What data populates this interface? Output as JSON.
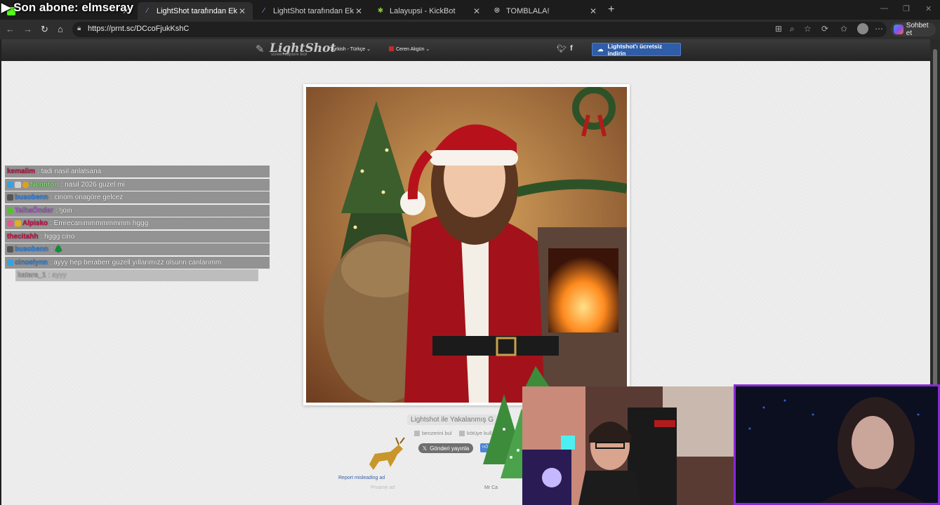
{
  "overlay": {
    "title": "Son abone: elmseray"
  },
  "tabs": [
    {
      "label": "",
      "favicon": "kick-icon",
      "active": false
    },
    {
      "label": "LightShot tarafından Ekran Görünt",
      "favicon": "feather-icon",
      "active": true
    },
    {
      "label": "LightShot tarafından Ekran Görünt",
      "favicon": "feather-icon",
      "active": false
    },
    {
      "label": "Lalayupsi - KickBot",
      "favicon": "kick-icon",
      "active": false
    },
    {
      "label": "TOMBLALA!",
      "favicon": "globe-icon",
      "active": false
    }
  ],
  "address": {
    "url": "https://prnt.sc/DCcoFjukKshC"
  },
  "copilot": {
    "label": "Sohbet et"
  },
  "lightshot": {
    "logo": "LightShot",
    "tagline": "screen capture tool",
    "language": "Turkish - Türkçe ⌄",
    "user": "Ceren Akgün ⌄",
    "download_label": "Lightshot'ı ücretsiz indirin",
    "caption": "Lightshot ile Yakalanmış G",
    "similar_label": "benzerini bul",
    "report_label": "kötüye kull",
    "share_label": "Gönderi yayınla",
    "report_ad": "Report misleading ad",
    "ad_text_1": "Prvarne ad",
    "ad_text_2": "Mr Ca"
  },
  "chat": [
    {
      "user": "kemalim",
      "msg": ": tadi nasil anlatsana",
      "color": "#c8174c"
    },
    {
      "user": "Nennton",
      "msg": ": nasil 2026 guzel mi",
      "color": "#7be26a"
    },
    {
      "user": "busobenn",
      "msg": ": cinom onagöre gelcez",
      "color": "#3b88e0"
    },
    {
      "user": "TalhaÖnder",
      "msg": ": !join",
      "color": "#b05ad8"
    },
    {
      "user": "Alpisko",
      "msg": ": Emrecanımmmmmmmm hggg",
      "color": "#c8174c"
    },
    {
      "user": "thecitahh",
      "msg": ": hggg cino",
      "color": "#c8174c"
    },
    {
      "user": "busobenn",
      "msg": ": 🌲",
      "color": "#3b88e0"
    },
    {
      "user": "cinoelynn",
      "msg": ": ayyy hep beraberr güzell yıllarımızz olsunn canlarımm",
      "color": "#3b88e0"
    },
    {
      "user": "katara_1",
      "msg": ": ayyy",
      "color": "#aaaaaa"
    }
  ],
  "colors": {
    "accent": "#2f5da8",
    "stream_border": "#8a2ad8"
  }
}
